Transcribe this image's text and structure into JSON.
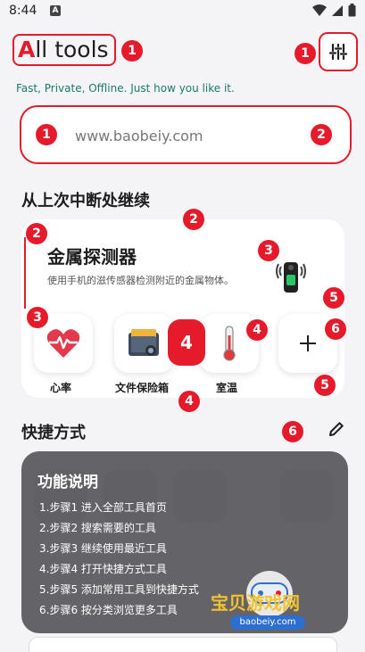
{
  "status_bar": {
    "time": "8:44",
    "notif": "A"
  },
  "header": {
    "title_first": "A",
    "title_rest": "ll tools",
    "tagline": "Fast, Private, Offline. Just how you like it."
  },
  "search": {
    "placeholder": "www.baobeiy.com"
  },
  "continue_section": {
    "title": "从上次中断处继续",
    "card_title": "金属探测器",
    "card_desc": "使用手机的滋传感器检测附近的金属物体。"
  },
  "apps": [
    {
      "label": "心率",
      "icon": "heart-pulse-icon"
    },
    {
      "label": "文件保险箱",
      "icon": "file-safe-icon"
    },
    {
      "label": "室温",
      "icon": "thermometer-icon"
    },
    {
      "label": "",
      "icon": "plus-icon"
    }
  ],
  "shortcuts": {
    "title": "快捷方式",
    "overlay_title": "功能说明",
    "steps": [
      "1.步骤1 进入全部工具首页",
      "2.步骤2 搜索需要的工具",
      "3.步骤3 继续使用最近工具",
      "4.步骤4 打开快捷方式工具",
      "5.步骤5 添加常用工具到快捷方式",
      "6.步骤6 按分类浏览更多工具"
    ]
  },
  "markers": [
    "1",
    "1",
    "1",
    "2",
    "2",
    "2",
    "3",
    "3",
    "4",
    "4",
    "4",
    "5",
    "5",
    "6",
    "6"
  ],
  "watermark": {
    "text": "宝贝游戏网",
    "url": "baobeiy.com"
  },
  "colors": {
    "accent": "#e51b2b",
    "tagline": "#1a7a6a",
    "watermark": "#f2c22f"
  }
}
